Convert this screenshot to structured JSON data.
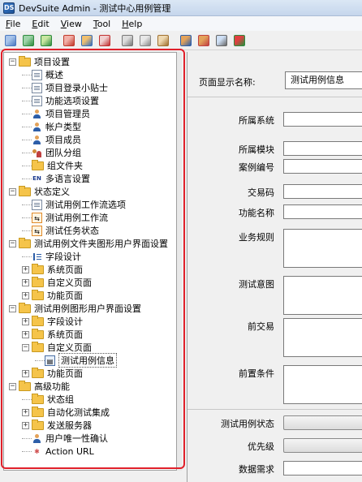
{
  "window": {
    "title": "DevSuite Admin - 测试中心用例管理",
    "app_icon_text": "DS"
  },
  "menu": [
    {
      "label": "File",
      "accel": "F"
    },
    {
      "label": "Edit",
      "accel": "E"
    },
    {
      "label": "View",
      "accel": "V"
    },
    {
      "label": "Tool",
      "accel": "T"
    },
    {
      "label": "Help",
      "accel": "H"
    }
  ],
  "toolbar": {
    "buttons": [
      "new-icon",
      "import-icon",
      "export-icon",
      "sep",
      "add-icon",
      "copy-project-icon",
      "delete-icon",
      "sep",
      "cut-icon",
      "copy-icon",
      "paste-icon",
      "sep",
      "user-icon",
      "group-icon",
      "search-icon",
      "connect-icon"
    ]
  },
  "tree": [
    {
      "label": "项目设置",
      "type": "folder",
      "level": 0,
      "expander": "minus"
    },
    {
      "label": "概述",
      "type": "doc",
      "level": 1
    },
    {
      "label": "项目登录小贴士",
      "type": "doc",
      "level": 1
    },
    {
      "label": "功能选项设置",
      "type": "doc",
      "level": 1
    },
    {
      "label": "项目管理员",
      "type": "person",
      "level": 1
    },
    {
      "label": "帐户类型",
      "type": "person",
      "level": 1
    },
    {
      "label": "项目成员",
      "type": "person",
      "level": 1
    },
    {
      "label": "团队分组",
      "type": "group",
      "level": 1
    },
    {
      "label": "组文件夹",
      "type": "folder",
      "level": 1
    },
    {
      "label": "多语言设置",
      "type": "en",
      "level": 1
    },
    {
      "label": "状态定义",
      "type": "folder",
      "level": 0,
      "expander": "minus"
    },
    {
      "label": "测试用例工作流选项",
      "type": "doc",
      "level": 1
    },
    {
      "label": "测试用例工作流",
      "type": "flow",
      "level": 1
    },
    {
      "label": "测试任务状态",
      "type": "flow",
      "level": 1
    },
    {
      "label": "测试用例文件夹图形用户界面设置",
      "type": "folder",
      "level": 0,
      "expander": "minus"
    },
    {
      "label": "字段设计",
      "type": "bar",
      "level": 1
    },
    {
      "label": "系统页面",
      "type": "folder",
      "level": 1,
      "expander": "plus"
    },
    {
      "label": "自定义页面",
      "type": "folder",
      "level": 1,
      "expander": "plus"
    },
    {
      "label": "功能页面",
      "type": "folder",
      "level": 1,
      "expander": "plus"
    },
    {
      "label": "测试用例图形用户界面设置",
      "type": "folder",
      "level": 0,
      "expander": "minus"
    },
    {
      "label": "字段设计",
      "type": "folder",
      "level": 1,
      "expander": "plus"
    },
    {
      "label": "系统页面",
      "type": "folder",
      "level": 1,
      "expander": "plus"
    },
    {
      "label": "自定义页面",
      "type": "folder",
      "level": 1,
      "expander": "minus"
    },
    {
      "label": "测试用例信息",
      "type": "screen",
      "level": 2
    },
    {
      "label": "功能页面",
      "type": "folder",
      "level": 1,
      "expander": "plus"
    },
    {
      "label": "高级功能",
      "type": "folder",
      "level": 0,
      "expander": "minus"
    },
    {
      "label": "状态组",
      "type": "folder",
      "level": 1
    },
    {
      "label": "自动化测试集成",
      "type": "folder",
      "level": 1,
      "expander": "plus"
    },
    {
      "label": "发送服务器",
      "type": "folder",
      "level": 1,
      "expander": "plus"
    },
    {
      "label": "用户唯一性确认",
      "type": "person",
      "level": 1
    },
    {
      "label": "Action URL",
      "type": "url",
      "level": 1
    }
  ],
  "form": {
    "page_display_name_label": "页面显示名称:",
    "page_display_name_value": "测试用例信息",
    "fields": [
      "所属系统",
      "所属模块",
      "案例编号",
      "交易码",
      "功能名称",
      "业务规则",
      "测试意图",
      "前交易",
      "前置条件",
      "测试用例状态",
      "优先级",
      "数据需求"
    ]
  }
}
